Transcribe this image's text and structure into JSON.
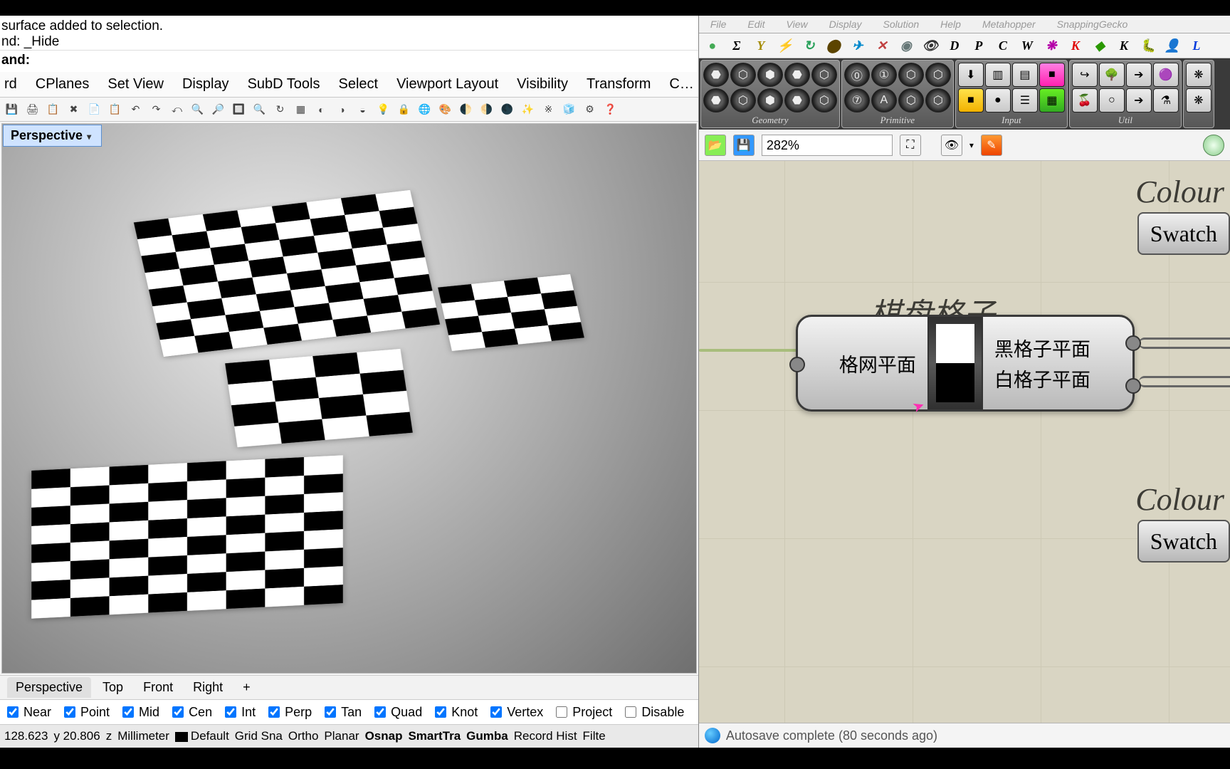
{
  "rhino": {
    "cmd_out1": "surface added to selection.",
    "cmd_out2": "nd: _Hide",
    "cmd_label": "and:",
    "menu": [
      "rd",
      "CPlanes",
      "Set View",
      "Display",
      "SubD Tools",
      "Select",
      "Viewport Layout",
      "Visibility",
      "Transform",
      "C…"
    ],
    "tool_icons": [
      "💾",
      "🖨",
      "📋",
      "✖",
      "📄",
      "📋",
      "↶",
      "↷",
      "⤺",
      "🔍",
      "🔎",
      "🔲",
      "🔍",
      "↻",
      "▦",
      "◐",
      "◑",
      "◒",
      "💡",
      "🔒",
      "🌐",
      "🎨",
      "🌓",
      "🌗",
      "🌑",
      "✨",
      "※",
      "🧊",
      "⚙",
      "❓"
    ],
    "viewport_label": "Perspective",
    "tabs": [
      "Perspective",
      "Top",
      "Front",
      "Right",
      "+"
    ],
    "osnap": [
      {
        "label": "Near",
        "checked": true
      },
      {
        "label": "Point",
        "checked": true
      },
      {
        "label": "Mid",
        "checked": true
      },
      {
        "label": "Cen",
        "checked": true
      },
      {
        "label": "Int",
        "checked": true
      },
      {
        "label": "Perp",
        "checked": true
      },
      {
        "label": "Tan",
        "checked": true
      },
      {
        "label": "Quad",
        "checked": true
      },
      {
        "label": "Knot",
        "checked": true
      },
      {
        "label": "Vertex",
        "checked": true
      },
      {
        "label": "Project",
        "checked": false
      },
      {
        "label": "Disable",
        "checked": false
      }
    ],
    "status": {
      "x": "128.623",
      "y": "y 20.806",
      "z": "z",
      "unit": "Millimeter",
      "layer": "Default",
      "items": [
        "Grid Sna",
        "Ortho",
        "Planar",
        "Osnap",
        "SmartTra",
        "Gumba",
        "Record Hist",
        "Filte"
      ]
    }
  },
  "gh": {
    "menu_faded": [
      "File",
      "Edit",
      "View",
      "Display",
      "Solution",
      "Help",
      "Metahopper",
      "SnappingGecko"
    ],
    "letters": [
      "●",
      "Σ",
      "Y",
      "⚡",
      "↻",
      "⬤",
      "✈",
      "✕",
      "◉",
      "👁",
      "D",
      "P",
      "C",
      "W",
      "❋",
      "K",
      "◆",
      "K",
      "🐛",
      "👤",
      "L"
    ],
    "letter_colors": [
      "#44aa55",
      "#000",
      "#a48b00",
      "#a05800",
      "#2aa25c",
      "#5c4400",
      "#0088cc",
      "#c04040",
      "#677",
      "#333",
      "#000",
      "#000",
      "#000",
      "#000",
      "#b400a8",
      "#e00000",
      "#2a9800",
      "#000",
      "#5aa03a",
      "#e08000",
      "#003bdc"
    ],
    "panels": [
      {
        "label": "Geometry",
        "rows": [
          [
            "⬣",
            "⬡",
            "⬢",
            "⬣",
            "⬡"
          ],
          [
            "⬣",
            "⬡",
            "⬢",
            "⬣",
            "⬡"
          ]
        ]
      },
      {
        "label": "Primitive",
        "rows": [
          [
            "⓪",
            "①",
            "⬡",
            "⬡"
          ],
          [
            "⑦",
            "A",
            "⬡",
            "⬡"
          ]
        ]
      },
      {
        "label": "Input",
        "rows": [
          [
            "⬇",
            "▥",
            "▤",
            "■"
          ],
          [
            "■",
            "●",
            "☰",
            "▦"
          ]
        ]
      },
      {
        "label": "Util",
        "rows": [
          [
            "↪",
            "🌳",
            "➔",
            "🟣"
          ],
          [
            "🍒",
            "○",
            "➔",
            "⚗"
          ]
        ]
      },
      {
        "label": "",
        "rows": [
          [
            "❋"
          ],
          [
            "❋"
          ]
        ]
      }
    ],
    "zoom": "282%",
    "scribbles": {
      "title": "棋盘格子",
      "colour1": "Colour",
      "colour2": "Colour"
    },
    "swatch_label": "Swatch",
    "component": {
      "in": "格网平面",
      "out1": "黑格子平面",
      "out2": "白格子平面"
    },
    "status": "Autosave complete (80 seconds ago)"
  }
}
